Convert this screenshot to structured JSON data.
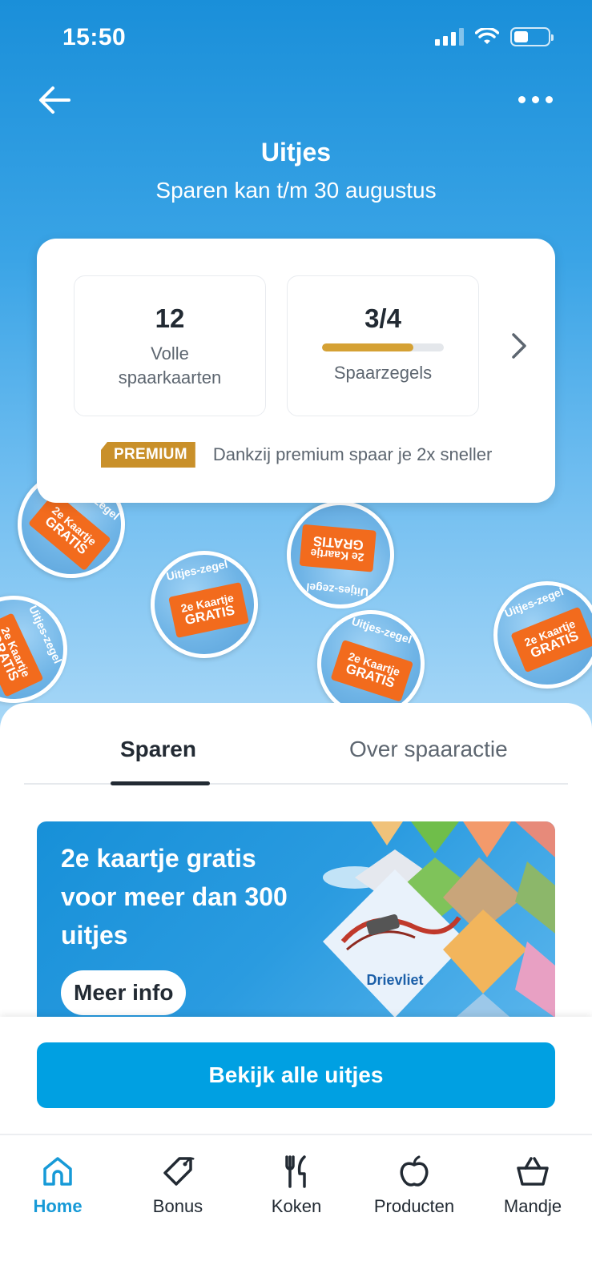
{
  "status_bar": {
    "time": "15:50"
  },
  "header": {
    "title": "Uitjes",
    "subtitle": "Sparen kan t/m 30 augustus"
  },
  "summary": {
    "full_cards_value": "12",
    "full_cards_label": "Volle spaarkaarten",
    "stamps_value": "3/4",
    "stamps_label": "Spaarzegels",
    "stamps_progress": 0.75,
    "premium_badge": "PREMIUM",
    "premium_text": "Dankzij premium spaar je 2x sneller"
  },
  "stamp": {
    "rim": "Uitjes-zegel",
    "line1": "2e Kaartje",
    "line2": "GRATIS"
  },
  "tabs": [
    {
      "label": "Sparen",
      "active": true
    },
    {
      "label": "Over spaaractie",
      "active": false
    }
  ],
  "banner": {
    "text": "2e kaartje gratis voor meer dan 300 uitjes",
    "button": "Meer info",
    "collage_logo": "Drievliet"
  },
  "cta": {
    "label": "Bekijk alle uitjes"
  },
  "bottom_nav": [
    {
      "label": "Home",
      "icon": "home-icon",
      "active": true
    },
    {
      "label": "Bonus",
      "icon": "tag-icon",
      "active": false
    },
    {
      "label": "Koken",
      "icon": "cutlery-icon",
      "active": false
    },
    {
      "label": "Producten",
      "icon": "apple-icon",
      "active": false
    },
    {
      "label": "Mandje",
      "icon": "basket-icon",
      "active": false
    }
  ],
  "colors": {
    "hero_blue": "#1a8fd9",
    "accent_blue": "#00a0e2",
    "premium_gold": "#c9902a",
    "stamp_orange": "#f26b1d",
    "active_nav": "#179ad7"
  }
}
